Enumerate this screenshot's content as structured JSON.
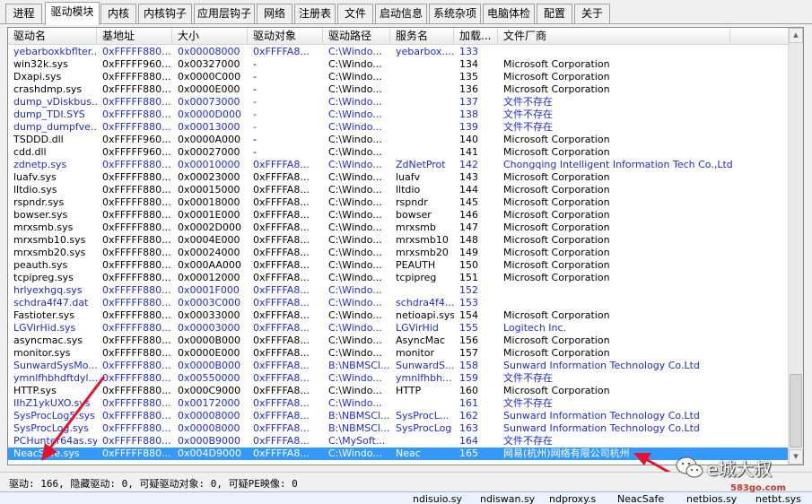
{
  "tabs": [
    {
      "label": "进程",
      "active": false
    },
    {
      "label": "驱动模块",
      "active": true
    },
    {
      "label": "内核",
      "active": false
    },
    {
      "label": "内核钩子",
      "active": false
    },
    {
      "label": "应用层钩子",
      "active": false
    },
    {
      "label": "网络",
      "active": false
    },
    {
      "label": "注册表",
      "active": false
    },
    {
      "label": "文件",
      "active": false
    },
    {
      "label": "启动信息",
      "active": false
    },
    {
      "label": "系统杂项",
      "active": false
    },
    {
      "label": "电脑体检",
      "active": false
    },
    {
      "label": "配置",
      "active": false
    },
    {
      "label": "关于",
      "active": false
    }
  ],
  "columns": [
    "驱动名",
    "基地址",
    "大小",
    "驱动对象",
    "驱动路径",
    "服务名",
    "加载...",
    "文件厂商"
  ],
  "rows": [
    {
      "name": "yebarboxkbflter...",
      "base": "0xFFFFF880...",
      "size": "0x00008000",
      "object": "0xFFFFA8...",
      "path": "C:\\Windo...",
      "service": "yebarbox....",
      "order": "133",
      "vendor": "",
      "color": "blue"
    },
    {
      "name": "win32k.sys",
      "base": "0xFFFFF960...",
      "size": "0x00327000",
      "object": "-",
      "path": "C:\\Windo...",
      "service": "",
      "order": "134",
      "vendor": "Microsoft Corporation",
      "color": "black"
    },
    {
      "name": "Dxapi.sys",
      "base": "0xFFFFF880...",
      "size": "0x0000C000",
      "object": "-",
      "path": "C:\\Windo...",
      "service": "",
      "order": "135",
      "vendor": "Microsoft Corporation",
      "color": "black"
    },
    {
      "name": "crashdmp.sys",
      "base": "0xFFFFF880...",
      "size": "0x0000E000",
      "object": "-",
      "path": "C:\\Windo...",
      "service": "",
      "order": "136",
      "vendor": "Microsoft Corporation",
      "color": "black"
    },
    {
      "name": "dump_vDiskbus...",
      "base": "0xFFFFF880...",
      "size": "0x00073000",
      "object": "-",
      "path": "C:\\Windo...",
      "service": "",
      "order": "137",
      "vendor": "文件不存在",
      "color": "blue"
    },
    {
      "name": "dump_TDI.SYS",
      "base": "0xFFFFF880...",
      "size": "0x0000D000",
      "object": "-",
      "path": "C:\\Windo...",
      "service": "",
      "order": "138",
      "vendor": "文件不存在",
      "color": "blue"
    },
    {
      "name": "dump_dumpfve...",
      "base": "0xFFFFF880...",
      "size": "0x00013000",
      "object": "-",
      "path": "C:\\Windo...",
      "service": "",
      "order": "139",
      "vendor": "文件不存在",
      "color": "blue"
    },
    {
      "name": "TSDDD.dll",
      "base": "0xFFFFF960...",
      "size": "0x0000A000",
      "object": "-",
      "path": "C:\\Windo...",
      "service": "",
      "order": "140",
      "vendor": "Microsoft Corporation",
      "color": "black"
    },
    {
      "name": "cdd.dll",
      "base": "0xFFFFF960...",
      "size": "0x00027000",
      "object": "-",
      "path": "C:\\Windo...",
      "service": "",
      "order": "141",
      "vendor": "Microsoft Corporation",
      "color": "black"
    },
    {
      "name": "zdnetp.sys",
      "base": "0xFFFFF880...",
      "size": "0x00010000",
      "object": "0xFFFFA8...",
      "path": "C:\\Windo...",
      "service": "ZdNetProt",
      "order": "142",
      "vendor": "Chongqing Intelligent Information Tech Co.,Ltd",
      "color": "blue"
    },
    {
      "name": "luafv.sys",
      "base": "0xFFFFF880...",
      "size": "0x00023000",
      "object": "0xFFFFA8...",
      "path": "C:\\Windo...",
      "service": "luafv",
      "order": "143",
      "vendor": "Microsoft Corporation",
      "color": "black"
    },
    {
      "name": "lltdio.sys",
      "base": "0xFFFFF880...",
      "size": "0x00015000",
      "object": "0xFFFFA8...",
      "path": "C:\\Windo...",
      "service": "lltdio",
      "order": "144",
      "vendor": "Microsoft Corporation",
      "color": "black"
    },
    {
      "name": "rspndr.sys",
      "base": "0xFFFFF880...",
      "size": "0x00018000",
      "object": "0xFFFFA8...",
      "path": "C:\\Windo...",
      "service": "rspndr",
      "order": "145",
      "vendor": "Microsoft Corporation",
      "color": "black"
    },
    {
      "name": "bowser.sys",
      "base": "0xFFFFF880...",
      "size": "0x0001E000",
      "object": "0xFFFFA8...",
      "path": "C:\\Windo...",
      "service": "bowser",
      "order": "146",
      "vendor": "Microsoft Corporation",
      "color": "black"
    },
    {
      "name": "mrxsmb.sys",
      "base": "0xFFFFF880...",
      "size": "0x0002D000",
      "object": "0xFFFFA8...",
      "path": "C:\\Windo...",
      "service": "mrxsmb",
      "order": "147",
      "vendor": "Microsoft Corporation",
      "color": "black"
    },
    {
      "name": "mrxsmb10.sys",
      "base": "0xFFFFF880...",
      "size": "0x0004E000",
      "object": "0xFFFFA8...",
      "path": "C:\\Windo...",
      "service": "mrxsmb10",
      "order": "148",
      "vendor": "Microsoft Corporation",
      "color": "black"
    },
    {
      "name": "mrxsmb20.sys",
      "base": "0xFFFFF880...",
      "size": "0x00024000",
      "object": "0xFFFFA8...",
      "path": "C:\\Windo...",
      "service": "mrxsmb20",
      "order": "149",
      "vendor": "Microsoft Corporation",
      "color": "black"
    },
    {
      "name": "peauth.sys",
      "base": "0xFFFFF880...",
      "size": "0x000AA000",
      "object": "0xFFFFA8...",
      "path": "C:\\Windo...",
      "service": "PEAUTH",
      "order": "150",
      "vendor": "Microsoft Corporation",
      "color": "black"
    },
    {
      "name": "tcpipreg.sys",
      "base": "0xFFFFF880...",
      "size": "0x00012000",
      "object": "0xFFFFA8...",
      "path": "C:\\Windo...",
      "service": "tcpipreg",
      "order": "151",
      "vendor": "Microsoft Corporation",
      "color": "black"
    },
    {
      "name": "hrlyexhgq.sys",
      "base": "0xFFFFF880...",
      "size": "0x0001F000",
      "object": "0xFFFFA8...",
      "path": "C:\\Windo...",
      "service": "",
      "order": "152",
      "vendor": "",
      "color": "blue"
    },
    {
      "name": "schdra4f47.dat",
      "base": "0xFFFFF880...",
      "size": "0x0003C000",
      "object": "0xFFFFA8...",
      "path": "C:\\Windo...",
      "service": "schdra4f4...",
      "order": "153",
      "vendor": "",
      "color": "blue"
    },
    {
      "name": "Fastioter.sys",
      "base": "0xFFFFF880...",
      "size": "0x00033000",
      "object": "0xFFFFA8...",
      "path": "C:\\Windo...",
      "service": "netioapi.sys",
      "order": "154",
      "vendor": "Microsoft Corporation",
      "color": "black"
    },
    {
      "name": "LGVirHid.sys",
      "base": "0xFFFFF880...",
      "size": "0x00003000",
      "object": "0xFFFFA8...",
      "path": "C:\\Windo...",
      "service": "LGVirHid",
      "order": "155",
      "vendor": "Logitech Inc.",
      "color": "blue"
    },
    {
      "name": "asyncmac.sys",
      "base": "0xFFFFF880...",
      "size": "0x0000B000",
      "object": "0xFFFFA8...",
      "path": "C:\\Windo...",
      "service": "AsyncMac",
      "order": "156",
      "vendor": "Microsoft Corporation",
      "color": "black"
    },
    {
      "name": "monitor.sys",
      "base": "0xFFFFF880...",
      "size": "0x0000E000",
      "object": "0xFFFFA8...",
      "path": "C:\\Windo...",
      "service": "monitor",
      "order": "157",
      "vendor": "Microsoft Corporation",
      "color": "black"
    },
    {
      "name": "SunwardSysMo...",
      "base": "0xFFFFF880...",
      "size": "0x0000B000",
      "object": "0xFFFFA8...",
      "path": "B:\\NBMSCl...",
      "service": "SunwardS...",
      "order": "158",
      "vendor": "Sunward Information Technology Co.Ltd",
      "color": "blue"
    },
    {
      "name": "ymnlfhbhdftdyl...",
      "base": "0xFFFFF880...",
      "size": "0x00550000",
      "object": "0xFFFFA8...",
      "path": "C:\\Windo...",
      "service": "ymnlfhbh...",
      "order": "159",
      "vendor": "文件不存在",
      "color": "blue"
    },
    {
      "name": "HTTP.sys",
      "base": "0xFFFFF880...",
      "size": "0x000C9000",
      "object": "0xFFFFA8...",
      "path": "C:\\Windo...",
      "service": "HTTP",
      "order": "160",
      "vendor": "Microsoft Corporation",
      "color": "black"
    },
    {
      "name": "IIhZ1ykUXO.sys",
      "base": "0xFFFFF880...",
      "size": "0x00172000",
      "object": "0xFFFFA8...",
      "path": "C:\\Windo...",
      "service": "",
      "order": "161",
      "vendor": "文件不存在",
      "color": "blue"
    },
    {
      "name": "SysProcLog5.sys",
      "base": "0xFFFFF880...",
      "size": "0x00008000",
      "object": "0xFFFFA8...",
      "path": "B:\\NBMSCl...",
      "service": "SysProcL...",
      "order": "162",
      "vendor": "Sunward Information Technology Co.Ltd",
      "color": "blue"
    },
    {
      "name": "SysProcLog.sys",
      "base": "0xFFFFF880...",
      "size": "0x00008000",
      "object": "0xFFFFA8...",
      "path": "B:\\NBMSCl...",
      "service": "SysProcLog",
      "order": "163",
      "vendor": "Sunward Information Technology Co.Ltd",
      "color": "blue"
    },
    {
      "name": "PCHunter64as.sys",
      "base": "0xFFFFF880...",
      "size": "0x000B9000",
      "object": "0xFFFFA8...",
      "path": "C:\\MySoft...",
      "service": "",
      "order": "164",
      "vendor": "文件不存在",
      "color": "blue"
    },
    {
      "name": "NeacSafe.sys",
      "base": "0xFFFFF880...",
      "size": "0x004D9000",
      "object": "0xFFFFA8...",
      "path": "C:\\Windo...",
      "service": "Neac",
      "order": "165",
      "vendor": "网易(杭州)网络有限公司杭州",
      "color": "selected"
    }
  ],
  "status": "驱动: 166, 隐藏驱动: 0, 可疑驱动对象: 0, 可疑PE映像: 0",
  "taskbar": [
    "ndisuio.sy",
    "ndiswan.sy",
    "ndproxy.s",
    "NeacSafe",
    "netbios.sy",
    "netbt.sys"
  ],
  "watermark": {
    "text": "e城大叔",
    "url": "583go.com"
  },
  "colors": {
    "blue_text": "#1c2bd7",
    "selection": "#3399ff",
    "annotation_arrow": "#e8102a"
  }
}
